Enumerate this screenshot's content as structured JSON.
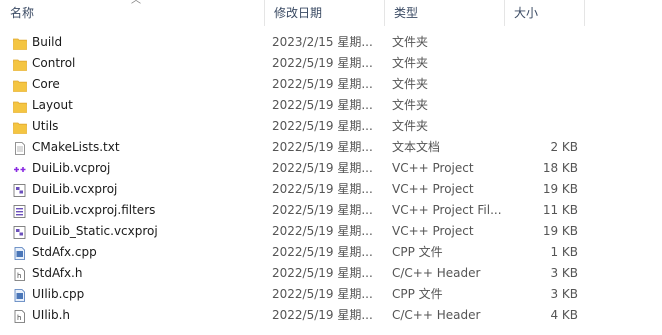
{
  "columns": {
    "name": "名称",
    "modified": "修改日期",
    "type": "类型",
    "size": "大小"
  },
  "files": [
    {
      "name": "Build",
      "modified": "2023/2/15 星期...",
      "type": "文件夹",
      "size": "",
      "icon": "folder-icon"
    },
    {
      "name": "Control",
      "modified": "2022/5/19 星期...",
      "type": "文件夹",
      "size": "",
      "icon": "folder-icon"
    },
    {
      "name": "Core",
      "modified": "2022/5/19 星期...",
      "type": "文件夹",
      "size": "",
      "icon": "folder-icon"
    },
    {
      "name": "Layout",
      "modified": "2022/5/19 星期...",
      "type": "文件夹",
      "size": "",
      "icon": "folder-icon"
    },
    {
      "name": "Utils",
      "modified": "2022/5/19 星期...",
      "type": "文件夹",
      "size": "",
      "icon": "folder-icon"
    },
    {
      "name": "CMakeLists.txt",
      "modified": "2022/5/19 星期...",
      "type": "文本文档",
      "size": "2 KB",
      "icon": "text-file-icon"
    },
    {
      "name": "DuiLib.vcproj",
      "modified": "2022/5/19 星期...",
      "type": "VC++ Project",
      "size": "18 KB",
      "icon": "vcproj-file-icon"
    },
    {
      "name": "DuiLib.vcxproj",
      "modified": "2022/5/19 星期...",
      "type": "VC++ Project",
      "size": "19 KB",
      "icon": "vcxproj-file-icon"
    },
    {
      "name": "DuiLib.vcxproj.filters",
      "modified": "2022/5/19 星期...",
      "type": "VC++ Project Fil...",
      "size": "11 KB",
      "icon": "filters-file-icon"
    },
    {
      "name": "DuiLib_Static.vcxproj",
      "modified": "2022/5/19 星期...",
      "type": "VC++ Project",
      "size": "19 KB",
      "icon": "vcxproj-file-icon"
    },
    {
      "name": "StdAfx.cpp",
      "modified": "2022/5/19 星期...",
      "type": "CPP 文件",
      "size": "1 KB",
      "icon": "cpp-file-icon"
    },
    {
      "name": "StdAfx.h",
      "modified": "2022/5/19 星期...",
      "type": "C/C++ Header",
      "size": "3 KB",
      "icon": "header-file-icon"
    },
    {
      "name": "UIlib.cpp",
      "modified": "2022/5/19 星期...",
      "type": "CPP 文件",
      "size": "3 KB",
      "icon": "cpp-file-icon"
    },
    {
      "name": "UIlib.h",
      "modified": "2022/5/19 星期...",
      "type": "C/C++ Header",
      "size": "4 KB",
      "icon": "header-file-icon"
    }
  ],
  "colors": {
    "folder": "#f4c542",
    "folder_dark": "#e0a82e",
    "accent": "#2b63c6"
  }
}
